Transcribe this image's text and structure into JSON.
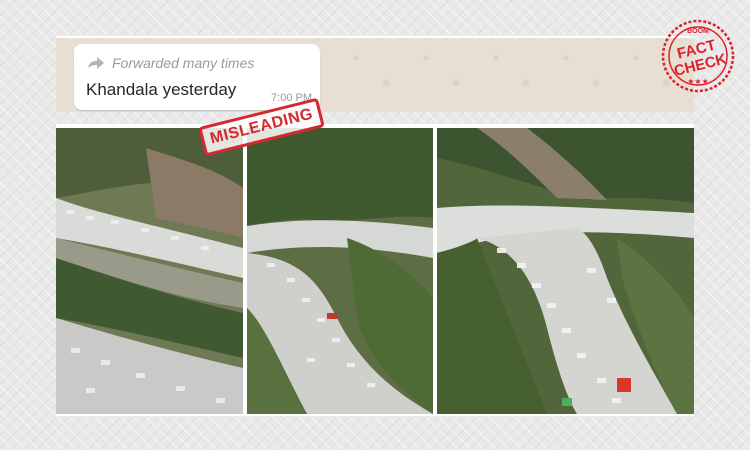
{
  "message": {
    "forward_label": "Forwarded many times",
    "text": "Khandala yesterday",
    "time": "7:00 PM"
  },
  "stamp": {
    "label": "MISLEADING",
    "color": "#d7282f"
  },
  "seal": {
    "top_text": "BOOM",
    "line1": "FACT",
    "line2": "CHECK",
    "color": "#e0202a"
  },
  "icons": {
    "forward": "forward-arrows-icon"
  },
  "colors": {
    "chat_background": "#e8dfd3",
    "bubble": "#ffffff",
    "meta_text": "#9a9a9a"
  }
}
